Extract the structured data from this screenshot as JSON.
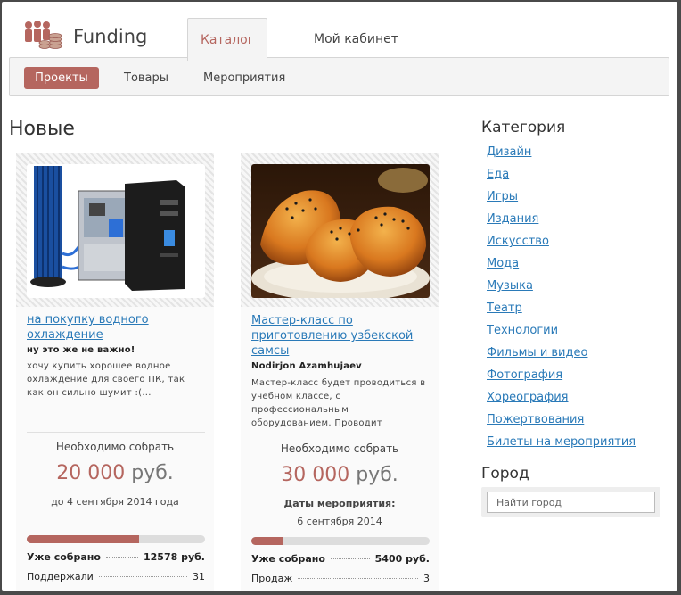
{
  "header": {
    "brand": "Funding",
    "tabs": [
      {
        "label": "Каталог"
      },
      {
        "label": "Мой кабинет"
      }
    ]
  },
  "subnav": {
    "items": [
      {
        "label": "Проекты"
      },
      {
        "label": "Товары"
      },
      {
        "label": "Мероприятия"
      }
    ]
  },
  "main": {
    "section_title": "Новые",
    "cards": [
      {
        "title": "на покупку водного охлаждение",
        "author": "ну это же не важно!",
        "description": "хочу купить хорошее водное охлаждение для своего ПК, так как он сильно шумит :(...",
        "need_label": "Необходимо собрать",
        "amount": "20 000",
        "currency": "руб.",
        "deadline": "до 4 сентября 2014 года",
        "progress": 0.63,
        "collected_label": "Уже собрано",
        "collected_value": "12578 руб.",
        "backers_label": "Поддержали",
        "backers_value": "31"
      },
      {
        "title": "Мастер-класс по приготовлению узбекской самсы",
        "author": "Nodirjon Azamhujaev",
        "description": "Мастер-класс будет проводиться в учебном классе, с профессиональным оборудованием. Проводит",
        "need_label": "Необходимо собрать",
        "amount": "30 000",
        "currency": "руб.",
        "dates_label": "Даты мероприятия:",
        "dates_value": "6 сентября 2014",
        "progress": 0.18,
        "collected_label": "Уже собрано",
        "collected_value": "5400 руб.",
        "sales_label": "Продаж",
        "sales_value": "3"
      }
    ]
  },
  "sidebar": {
    "category_title": "Категория",
    "categories": [
      {
        "label": "Дизайн"
      },
      {
        "label": "Еда"
      },
      {
        "label": "Игры"
      },
      {
        "label": "Издания"
      },
      {
        "label": "Искусство"
      },
      {
        "label": "Мода"
      },
      {
        "label": "Музыка"
      },
      {
        "label": "Театр"
      },
      {
        "label": "Технологии"
      },
      {
        "label": "Фильмы и видео"
      },
      {
        "label": "Фотография"
      },
      {
        "label": "Хореография"
      },
      {
        "label": "Пожертвования"
      },
      {
        "label": "Билеты на мероприятия"
      }
    ],
    "city_title": "Город",
    "city_placeholder": "Найти город"
  },
  "colors": {
    "accent": "#b5665f",
    "link": "#2a7ab8"
  },
  "icons": [
    "people-coins-logo-icon"
  ]
}
